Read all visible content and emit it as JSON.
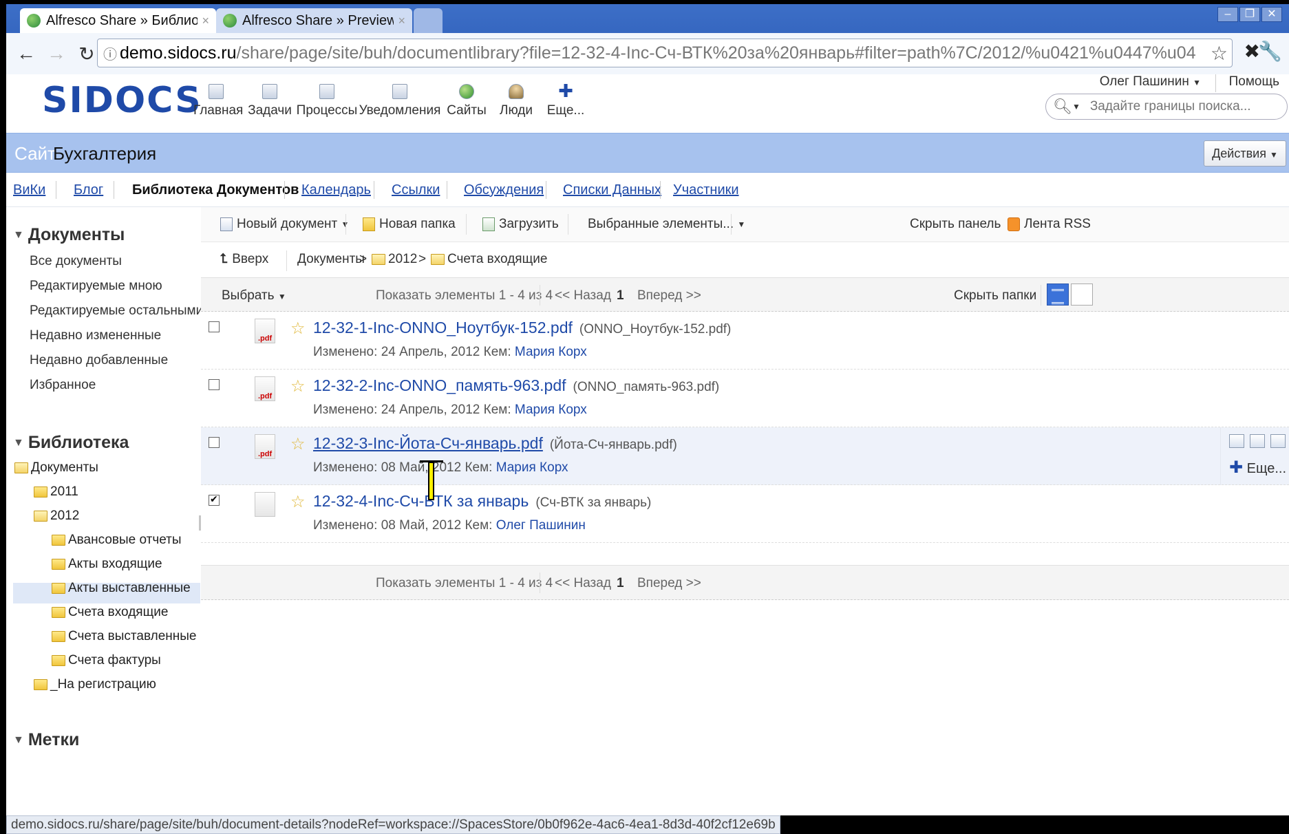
{
  "browser": {
    "tabs": [
      {
        "title": "Alfresco Share » Библио",
        "active": true
      },
      {
        "title": "Alfresco Share » Preview",
        "active": false
      }
    ],
    "url_host": "demo.sidocs.ru",
    "url_path": "/share/page/site/buh/documentlibrary?file=12-32-4-Inc-Сч-ВТК%20за%20январь#filter=path%7C/2012/%u0421%u0447%u04",
    "status_url": "demo.sidocs.ru/share/page/site/buh/document-details?nodeRef=workspace://SpacesStore/0b0f962e-4ac6-4ea1-8d3d-40f2cf12e69b"
  },
  "header": {
    "logo": "SIDOCS",
    "nav": [
      {
        "label": "Главная",
        "icon": "home-icon"
      },
      {
        "label": "Задачи",
        "icon": "tasks-icon"
      },
      {
        "label": "Процессы",
        "icon": "workflows-icon"
      },
      {
        "label": "Уведомления",
        "icon": "notifications-icon"
      },
      {
        "label": "Сайты",
        "icon": "globe-icon"
      },
      {
        "label": "Люди",
        "icon": "people-icon"
      },
      {
        "label": "Еще...",
        "icon": "plus-icon"
      }
    ],
    "user": "Олег Пашинин",
    "help": "Помощь",
    "search_placeholder": "Задайте границы поиска..."
  },
  "site": {
    "label": "Сайт",
    "name": "Бухгалтерия",
    "actions": "Действия"
  },
  "subnav": [
    "ВиКи",
    "Блог",
    "Библиотека Документов",
    "Календарь",
    "Ссылки",
    "Обсуждения",
    "Списки Данных",
    "Участники"
  ],
  "left": {
    "documents_head": "Документы",
    "documents": [
      "Все документы",
      "Редактируемые мною",
      "Редактируемые остальными",
      "Недавно измененные",
      "Недавно добавленные",
      "Избранное"
    ],
    "library_head": "Библиотека",
    "tree": [
      "Документы",
      "2011",
      "2012",
      "Авансовые отчеты",
      "Акты входящие",
      "Акты выставленные",
      "Счета входящие",
      "Счета выставленные",
      "Счета фактуры",
      "_На регистрацию"
    ],
    "tags_head": "Метки"
  },
  "toolbar": {
    "new_doc": "Новый документ",
    "new_folder": "Новая папка",
    "upload": "Загрузить",
    "selected": "Выбранные элементы...",
    "hide_panel": "Скрыть панель",
    "rss": "Лента RSS"
  },
  "path": {
    "up": "Вверх",
    "root": "Документы",
    "sep": ">",
    "level1": "2012",
    "level2": "Счета входящие"
  },
  "list": {
    "select": "Выбрать",
    "showing": "Показать элементы 1 - 4 из 4",
    "prev": "<< Назад",
    "page": "1",
    "next": "Вперед >>",
    "hide_folders": "Скрыть папки"
  },
  "files": [
    {
      "name": "12-32-1-Inc-ONNO_Ноутбук-152.pdf",
      "title": "(ONNO_Ноутбук-152.pdf)",
      "modified_label": "Изменено:",
      "date": "24 Апрель, 2012",
      "by_label": "Кем:",
      "user": "Мария Корх",
      "checked": false
    },
    {
      "name": "12-32-2-Inc-ONNO_память-963.pdf",
      "title": "(ONNO_память-963.pdf)",
      "modified_label": "Изменено:",
      "date": "24 Апрель, 2012",
      "by_label": "Кем:",
      "user": "Мария Корх",
      "checked": false
    },
    {
      "name": "12-32-3-Inc-Йота-Сч-январь.pdf",
      "title": "(Йота-Сч-январь.pdf)",
      "modified_label": "Изменено:",
      "date": "08 Май, 2012",
      "by_label": "Кем:",
      "user": "Мария Корх",
      "checked": false
    },
    {
      "name": "12-32-4-Inc-Сч-ВТК за январь",
      "title": "(Сч-ВТК за январь)",
      "modified_label": "Изменено:",
      "date": "08 Май, 2012",
      "by_label": "Кем:",
      "user": "Олег Пашинин",
      "checked": true
    }
  ],
  "row_actions": {
    "more": "Еще..."
  }
}
